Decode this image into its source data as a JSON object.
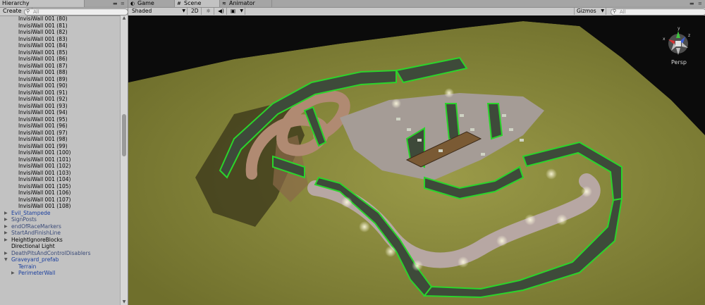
{
  "hierarchy": {
    "tab_label": "Hierarchy",
    "create_label": "Create",
    "search_placeholder": "All",
    "walls": [
      "InvisiWall 001 (80)",
      "InvisiWall 001 (81)",
      "InvisiWall 001 (82)",
      "InvisiWall 001 (83)",
      "InvisiWall 001 (84)",
      "InvisiWall 001 (85)",
      "InvisiWall 001 (86)",
      "InvisiWall 001 (87)",
      "InvisiWall 001 (88)",
      "InvisiWall 001 (89)",
      "InvisiWall 001 (90)",
      "InvisiWall 001 (91)",
      "InvisiWall 001 (92)",
      "InvisiWall 001 (93)",
      "InvisiWall 001 (94)",
      "InvisiWall 001 (95)",
      "InvisiWall 001 (96)",
      "InvisiWall 001 (97)",
      "InvisiWall 001 (98)",
      "InvisiWall 001 (99)",
      "InvisiWall 001 (100)",
      "InvisiWall 001 (101)",
      "InvisiWall 001 (102)",
      "InvisiWall 001 (103)",
      "InvisiWall 001 (104)",
      "InvisiWall 001 (105)",
      "InvisiWall 001 (106)",
      "InvisiWall 001 (107)",
      "InvisiWall 001 (108)"
    ],
    "objects": [
      {
        "label": "Evil_Stampede",
        "arrow": "▶",
        "style": "blue"
      },
      {
        "label": "SignPosts",
        "arrow": "▶",
        "style": "dim"
      },
      {
        "label": "endOfRaceMarkers",
        "arrow": "▶",
        "style": "dim"
      },
      {
        "label": "StartAndFinishLine",
        "arrow": "▶",
        "style": "dim"
      },
      {
        "label": "HeightIgnoreBlocks",
        "arrow": "▶",
        "style": "plain"
      },
      {
        "label": "Directional Light",
        "arrow": "",
        "style": "plain"
      },
      {
        "label": "DeathPitsAndControlDisablers",
        "arrow": "▶",
        "style": "dim"
      },
      {
        "label": "Graveyard_prefab",
        "arrow": "▼",
        "style": "blue"
      }
    ],
    "children": [
      "Terrain",
      "PerimeterWall"
    ]
  },
  "scene": {
    "tabs": [
      {
        "label": "Game",
        "icon": "game-icon"
      },
      {
        "label": "Scene",
        "icon": "scene-icon"
      },
      {
        "label": "Animator",
        "icon": "animator-icon"
      }
    ],
    "shading_mode": "Shaded",
    "mode_2d": "2D",
    "light_icon": "☼",
    "audio_icon": "◀)",
    "fx_icon": "▣",
    "gizmos_label": "Gizmos",
    "search_placeholder": "All",
    "persp_label": "Persp",
    "gizmo_axes": [
      "y",
      "x",
      "z"
    ],
    "colors": {
      "terrain": "#8a8a3c",
      "wall_glow": "#2bd42b",
      "background": "#0b0b0b"
    }
  }
}
